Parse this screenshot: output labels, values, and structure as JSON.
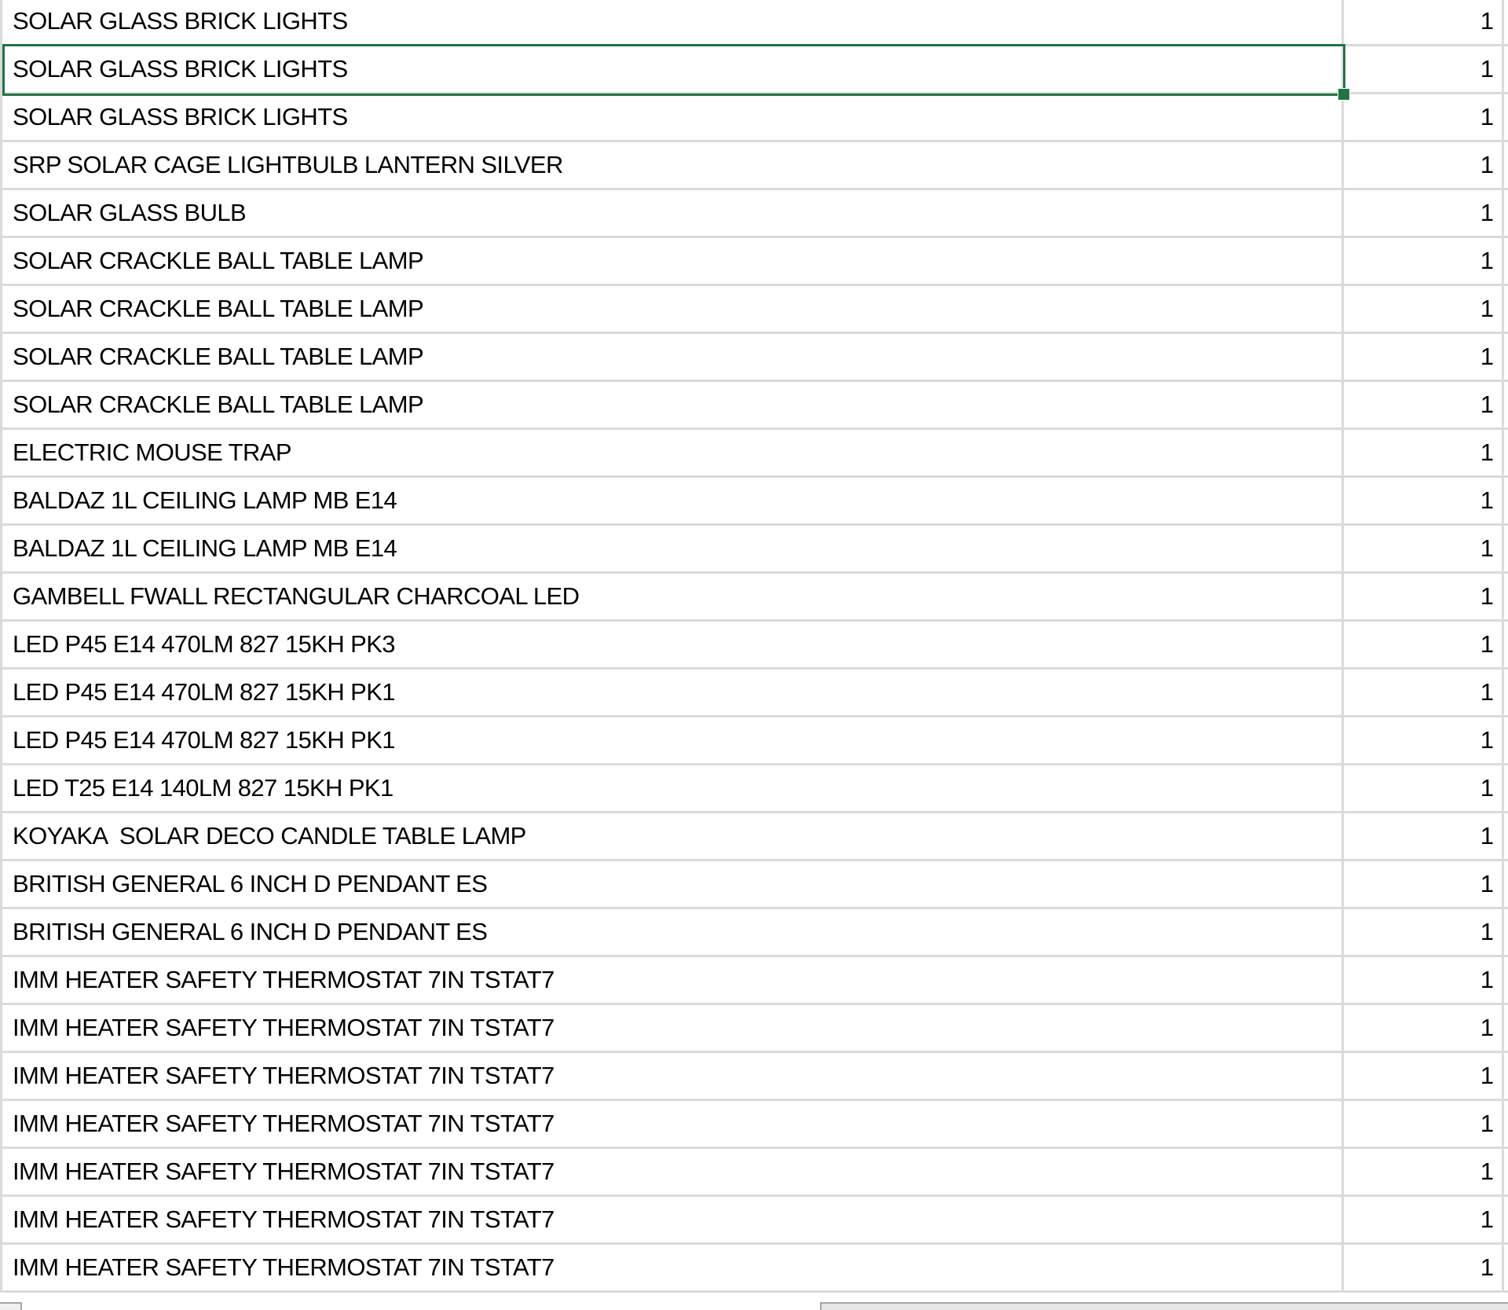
{
  "sheet": {
    "selected_row_index": 1,
    "accent_color": "#217346",
    "rows": [
      {
        "description": "SOLAR GLASS BRICK LIGHTS",
        "qty": "1"
      },
      {
        "description": "SOLAR GLASS BRICK LIGHTS",
        "qty": "1"
      },
      {
        "description": "SOLAR GLASS BRICK LIGHTS",
        "qty": "1"
      },
      {
        "description": "SRP SOLAR CAGE LIGHTBULB LANTERN SILVER",
        "qty": "1"
      },
      {
        "description": "SOLAR GLASS BULB",
        "qty": "1"
      },
      {
        "description": "SOLAR CRACKLE BALL TABLE LAMP",
        "qty": "1"
      },
      {
        "description": "SOLAR CRACKLE BALL TABLE LAMP",
        "qty": "1"
      },
      {
        "description": "SOLAR CRACKLE BALL TABLE LAMP",
        "qty": "1"
      },
      {
        "description": "SOLAR CRACKLE BALL TABLE LAMP",
        "qty": "1"
      },
      {
        "description": "ELECTRIC MOUSE TRAP",
        "qty": "1"
      },
      {
        "description": "BALDAZ 1L CEILING LAMP MB E14",
        "qty": "1"
      },
      {
        "description": "BALDAZ 1L CEILING LAMP MB E14",
        "qty": "1"
      },
      {
        "description": "GAMBELL FWALL RECTANGULAR CHARCOAL LED",
        "qty": "1"
      },
      {
        "description": "LED P45 E14 470LM 827 15KH PK3",
        "qty": "1"
      },
      {
        "description": "LED P45 E14 470LM 827 15KH PK1",
        "qty": "1"
      },
      {
        "description": "LED P45 E14 470LM 827 15KH PK1",
        "qty": "1"
      },
      {
        "description": "LED T25 E14 140LM 827 15KH PK1",
        "qty": "1"
      },
      {
        "description": "KOYAKA  SOLAR DECO CANDLE TABLE LAMP",
        "qty": "1"
      },
      {
        "description": "BRITISH GENERAL 6 INCH D PENDANT ES",
        "qty": "1"
      },
      {
        "description": "BRITISH GENERAL 6 INCH D PENDANT ES",
        "qty": "1"
      },
      {
        "description": "IMM HEATER SAFETY THERMOSTAT 7IN TSTAT7",
        "qty": "1"
      },
      {
        "description": "IMM HEATER SAFETY THERMOSTAT 7IN TSTAT7",
        "qty": "1"
      },
      {
        "description": "IMM HEATER SAFETY THERMOSTAT 7IN TSTAT7",
        "qty": "1"
      },
      {
        "description": "IMM HEATER SAFETY THERMOSTAT 7IN TSTAT7",
        "qty": "1"
      },
      {
        "description": "IMM HEATER SAFETY THERMOSTAT 7IN TSTAT7",
        "qty": "1"
      },
      {
        "description": "IMM HEATER SAFETY THERMOSTAT 7IN TSTAT7",
        "qty": "1"
      },
      {
        "description": "IMM HEATER SAFETY THERMOSTAT 7IN TSTAT7",
        "qty": "1"
      }
    ]
  }
}
